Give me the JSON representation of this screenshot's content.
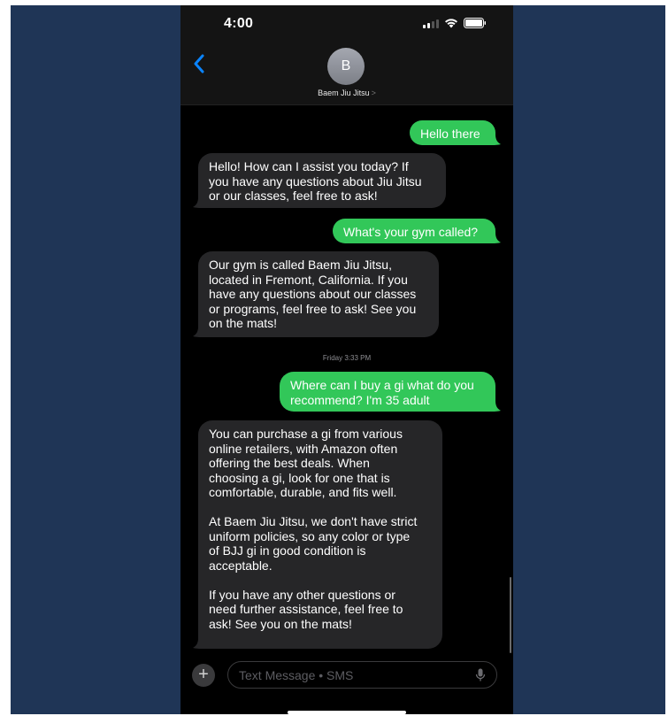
{
  "status_bar": {
    "time": "4:00"
  },
  "header": {
    "back_icon": "chevron-left-icon",
    "avatar_initial": "B",
    "contact_name": "Baem Jiu Jitsu",
    "contact_chevron": ">"
  },
  "messages": [
    {
      "sender": "me",
      "text": "Hello there"
    },
    {
      "sender": "them",
      "text": "Hello! How can I assist you today? If\nyou have any questions about Jiu Jitsu\nor our classes, feel free to ask!"
    },
    {
      "sender": "me",
      "text": "What's your gym called?"
    },
    {
      "sender": "them",
      "text": "Our gym is called Baem Jiu Jitsu,\nlocated in Fremont, California. If you\nhave any questions about our classes\nor programs, feel free to ask! See you\non the mats!"
    },
    {
      "sender": "me",
      "text": "Where can I buy a gi what do you\nrecommend? I'm 35 adult"
    },
    {
      "sender": "them",
      "text": "You can purchase a gi from various\nonline retailers, with Amazon often\noffering the best deals. When\nchoosing a gi, look for one that is\ncomfortable, durable, and fits well.\n\nAt Baem Jiu Jitsu, we don't have strict\nuniform policies, so any color or type\nof BJJ gi in good condition is\nacceptable.\n\nIf you have any other questions or\nneed further assistance, feel free to\nask! See you on the mats!"
    }
  ],
  "timestamp": "Friday 3:33 PM",
  "input_bar": {
    "plus_label": "+",
    "placeholder": "Text Message • SMS"
  },
  "colors": {
    "background": "#1f3556",
    "outgoing_bubble": "#32c759",
    "incoming_bubble": "#262628",
    "back_chevron": "#0a84ff"
  }
}
